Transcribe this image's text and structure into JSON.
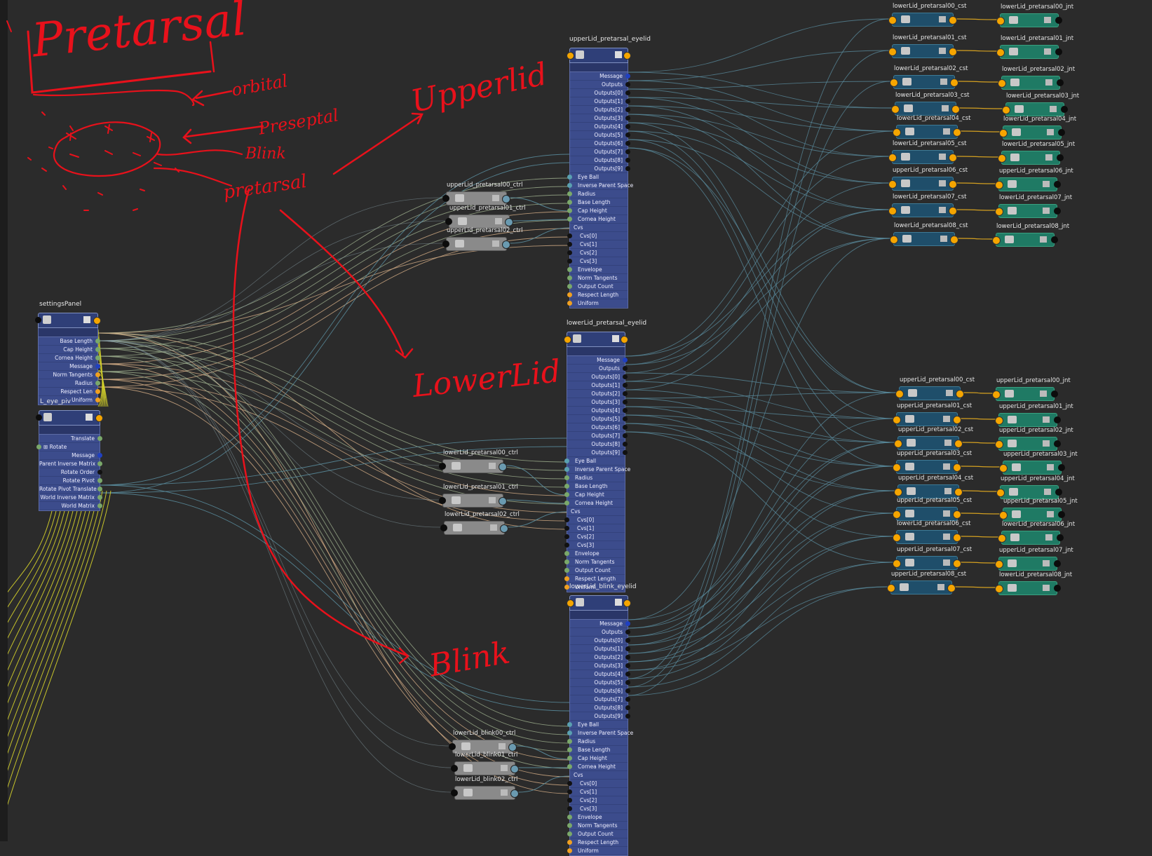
{
  "annotations": {
    "pretarsal_title": "Pretarsal",
    "orbital": "orbital",
    "preseptal": "Preseptal",
    "blink": "Blink",
    "pretarsal": "pretarsal",
    "upperlid": "Upperlid",
    "lowerlid": "LowerLid",
    "blink_big": "Blink"
  },
  "settings_panel": {
    "title": "settingsPanel",
    "attrs": [
      "Base Length",
      "Cap Height",
      "Cornea Height",
      "Message",
      "Norm Tangents",
      "Radius",
      "Respect Len",
      "Uniform"
    ]
  },
  "eye_piv": {
    "title": "L_eye_piv",
    "translate": "Translate",
    "rotate": "Rotate",
    "attrs": [
      "Message",
      "Parent Inverse Matrix",
      "Rotate Order",
      "Rotate Pivot",
      "Rotate Pivot Translate",
      "World Inverse Matrix",
      "World Matrix"
    ]
  },
  "eyelid_nodes": [
    {
      "title": "upperLid_pretarsal_eyelid"
    },
    {
      "title": "lowerLid_pretarsal_eyelid"
    },
    {
      "title": "lowerLid_blink_eyelid"
    }
  ],
  "eyelid_attrs": {
    "message": "Message",
    "outputs": "Outputs",
    "output_items": [
      "Outputs[0]",
      "Outputs[1]",
      "Outputs[2]",
      "Outputs[3]",
      "Outputs[4]",
      "Outputs[5]",
      "Outputs[6]",
      "Outputs[7]",
      "Outputs[8]",
      "Outputs[9]"
    ],
    "inputs_a": [
      "Eye Ball",
      "Inverse Parent Space",
      "Radius",
      "Base Length",
      "Cap Height",
      "Cornea Height"
    ],
    "cvs": "Cvs",
    "cv_items": [
      "Cvs[0]",
      "Cvs[1]",
      "Cvs[2]",
      "Cvs[3]"
    ],
    "inputs_b": [
      "Envelope",
      "Norm Tangents",
      "Output Count",
      "Respect Length",
      "Uniform"
    ]
  },
  "ctrl_nodes": [
    "upperLid_pretarsal00_ctrl",
    "upperLid_pretarsal01_ctrl",
    "upperLid_pretarsal02_ctrl",
    "lowerLid_pretarsal00_ctrl",
    "lowerLid_pretarsal01_ctrl",
    "lowerLid_pretarsal02_ctrl",
    "lowerLid_blink00_ctrl",
    "lowerLid_blink01_ctrl",
    "lowerLid_blink02_ctrl"
  ],
  "cst_nodes": [
    "lowerLid_pretarsal00_cst",
    "lowerLid_pretarsal01_cst",
    "lowerLid_pretarsal02_cst",
    "lowerLid_pretarsal03_cst",
    "lowerLid_pretarsal04_cst",
    "lowerLid_pretarsal05_cst",
    "upperLid_pretarsal06_cst",
    "lowerLid_pretarsal07_cst",
    "lowerLid_pretarsal08_cst",
    "upperLid_pretarsal00_cst",
    "upperLid_pretarsal01_cst",
    "upperLid_pretarsal02_cst",
    "upperLid_pretarsal03_cst",
    "upperLid_pretarsal04_cst",
    "upperLid_pretarsal05_cst",
    "lowerLid_pretarsal06_cst",
    "upperLid_pretarsal07_cst",
    "upperLid_pretarsal08_cst"
  ],
  "jnt_nodes": [
    "lowerLid_pretarsal00_jnt",
    "lowerLid_pretarsal01_jnt",
    "lowerLid_pretarsal02_jnt",
    "lowerLid_pretarsal03_jnt",
    "lowerLid_pretarsal04_jnt",
    "lowerLid_pretarsal05_jnt",
    "upperLid_pretarsal06_jnt",
    "lowerLid_pretarsal07_jnt",
    "lowerLid_pretarsal08_jnt",
    "upperLid_pretarsal00_jnt",
    "upperLid_pretarsal01_jnt",
    "upperLid_pretarsal02_jnt",
    "upperLid_pretarsal03_jnt",
    "upperLid_pretarsal04_jnt",
    "upperLid_pretarsal05_jnt",
    "lowerLid_pretarsal06_jnt",
    "upperLid_pretarsal07_jnt",
    "lowerLid_pretarsal08_jnt"
  ],
  "colors": {
    "background": "#2b2b2b",
    "node_blue": "#3c4c8c",
    "cst_node": "#1f4e6a",
    "jnt_node": "#1f7a64",
    "ctrl_node": "#8a8a8a",
    "wire_teal": "#5b8ea0",
    "wire_tan": "#d8b088",
    "wire_yellow": "#d6d32a",
    "wire_orange": "#d4a020",
    "annotation_red": "#e8111b"
  }
}
